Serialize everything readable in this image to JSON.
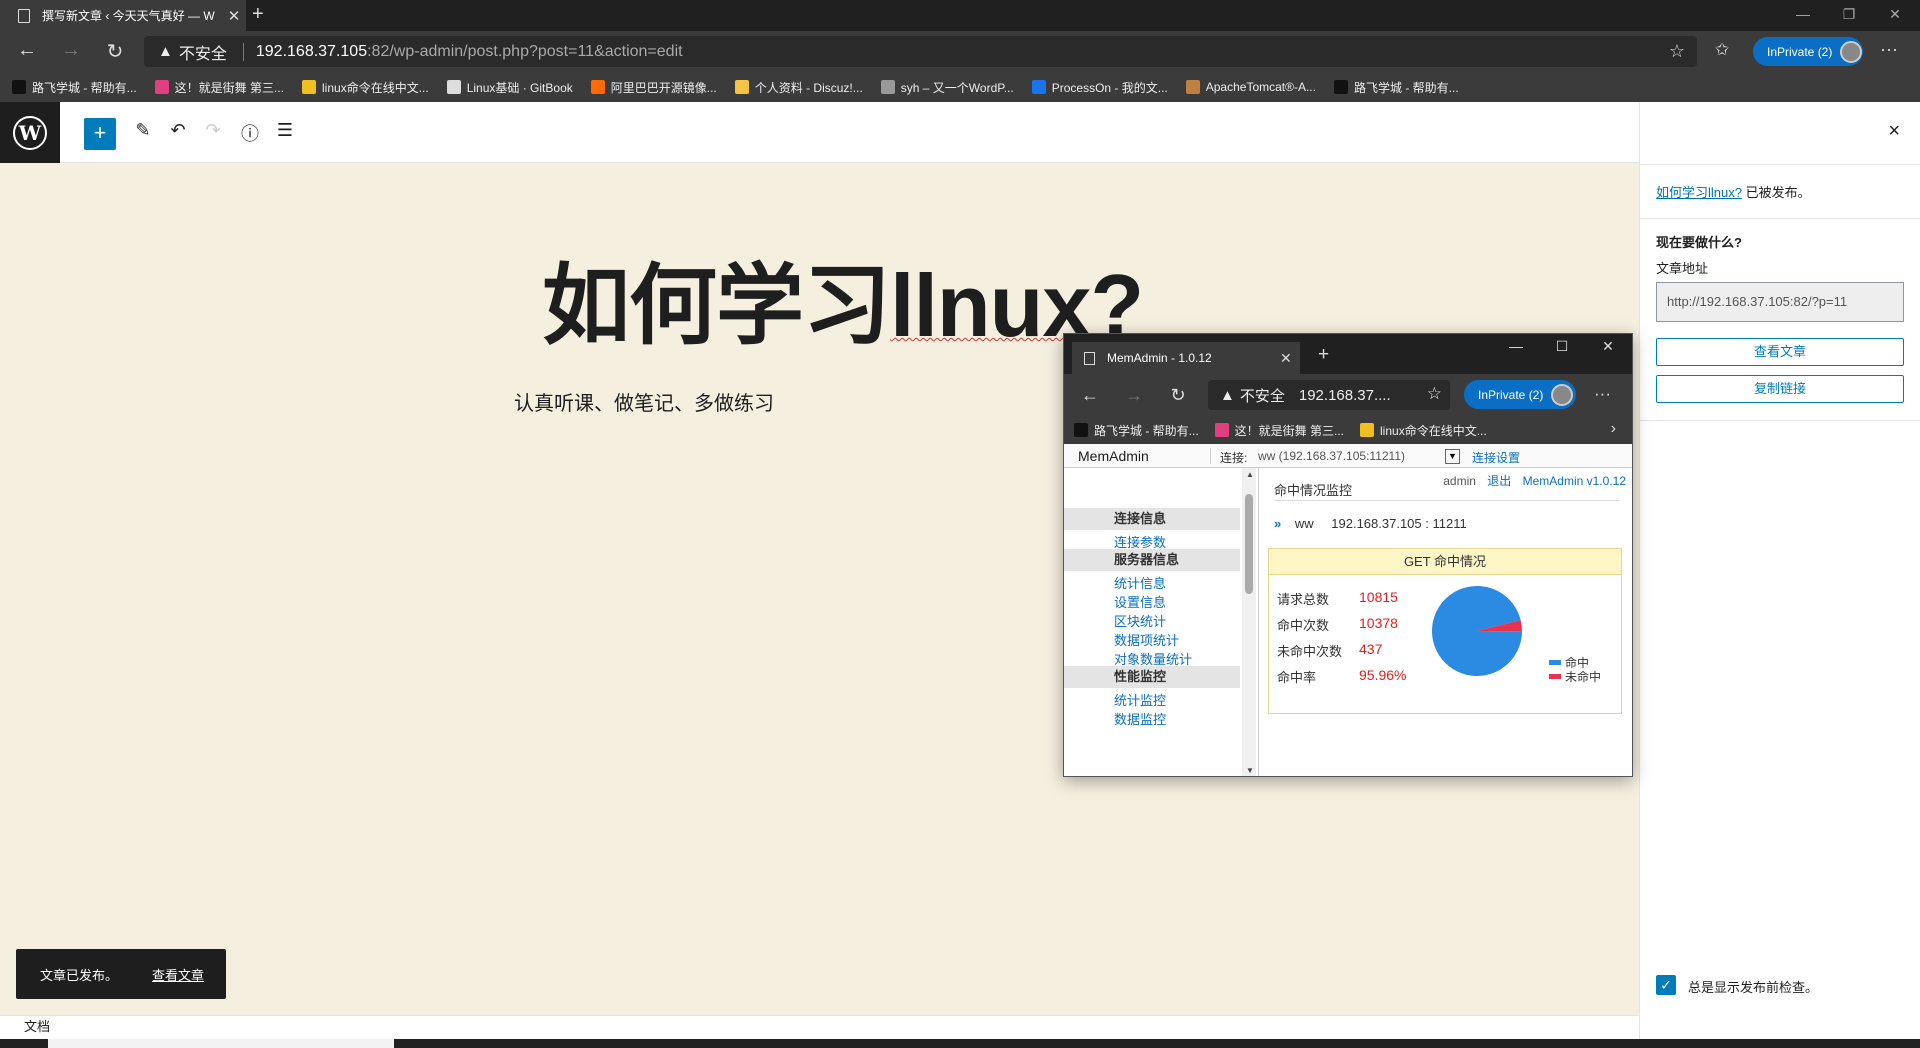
{
  "browser": {
    "tab_title": "撰写新文章 ‹ 今天天气真好 — W",
    "insecure_label": "不安全",
    "url_host": "192.168.37.105",
    "url_rest": ":82/wp-admin/post.php?post=11&action=edit",
    "inprivate_label": "InPrivate (2)",
    "bookmarks": [
      {
        "label": "路飞学城 - 帮助有...",
        "color": "#111111"
      },
      {
        "label": "这！就是街舞 第三...",
        "color": "#e04080"
      },
      {
        "label": "linux命令在线中文...",
        "color": "#f0c020"
      },
      {
        "label": "Linux基础 · GitBook",
        "color": "#dddddd"
      },
      {
        "label": "阿里巴巴开源镜像...",
        "color": "#ff6a00"
      },
      {
        "label": "个人资料 - Discuz!...",
        "color": "#f5c542"
      },
      {
        "label": "syh – 又一个WordP...",
        "color": "#999999"
      },
      {
        "label": "ProcessOn - 我的文...",
        "color": "#1a73e8"
      },
      {
        "label": "ApacheTomcat®-A...",
        "color": "#c08040"
      },
      {
        "label": "路飞学城 - 帮助有...",
        "color": "#111111"
      }
    ]
  },
  "editor": {
    "logo_text": "W",
    "add_symbol": "+",
    "title_prefix": "如何学习",
    "title_word": "llnux",
    "title_suffix": "?",
    "body_text": "认真听课、做笔记、多做练习",
    "snackbar_text": "文章已发布。",
    "snackbar_link": "查看文章",
    "footer_label": "文档"
  },
  "sidebar": {
    "close_symbol": "×",
    "published_link": "如何学习llnux?",
    "published_suffix": " 已被发布。",
    "question": "现在要做什么?",
    "address_label": "文章地址",
    "address_value": "http://192.168.37.105:82/?p=11",
    "view_post_button": "查看文章",
    "copy_link_button": "复制链接",
    "checkbox_label": "总是显示发布前检查。",
    "checkbox_checked": true
  },
  "popup": {
    "tab_title": "MemAdmin - 1.0.12",
    "insecure_label": "不安全",
    "url_text": "192.168.37....",
    "inprivate_label": "InPrivate (2)",
    "bookmarks": [
      {
        "label": "路飞学城 - 帮助有...",
        "color": "#111111"
      },
      {
        "label": "这！就是街舞 第三...",
        "color": "#e04080"
      },
      {
        "label": "linux命令在线中文...",
        "color": "#f0c020"
      }
    ],
    "memadmin": {
      "brand": "MemAdmin",
      "conn_label": "连接:",
      "conn_value": "ww (192.168.37.105:11211)",
      "conn_settings": "连接设置",
      "user": "admin",
      "logout": "退出",
      "version": "MemAdmin v1.0.12",
      "page_title": "命中情况监控",
      "server_name": "ww",
      "server_addr": "192.168.37.105 : 11211",
      "box_title": "GET 命中情况",
      "menu": [
        {
          "type": "section",
          "label": "连接信息"
        },
        {
          "type": "link",
          "label": "连接参数"
        },
        {
          "type": "section",
          "label": "服务器信息"
        },
        {
          "type": "link",
          "label": "统计信息"
        },
        {
          "type": "link",
          "label": "设置信息"
        },
        {
          "type": "link",
          "label": "区块统计"
        },
        {
          "type": "link",
          "label": "数据项统计"
        },
        {
          "type": "link",
          "label": "对象数量统计"
        },
        {
          "type": "section",
          "label": "性能监控"
        },
        {
          "type": "link",
          "label": "统计监控"
        },
        {
          "type": "link",
          "label": "数据监控"
        }
      ],
      "stats": [
        {
          "label": "请求总数",
          "value": "10815"
        },
        {
          "label": "命中次数",
          "value": "10378"
        },
        {
          "label": "未命中次数",
          "value": "437"
        },
        {
          "label": "命中率",
          "value": "95.96%"
        }
      ],
      "legend": [
        {
          "label": "命中",
          "color": "#2b8ae2"
        },
        {
          "label": "未命中",
          "color": "#e8334f"
        }
      ],
      "pie": {
        "hit": 10378,
        "miss": 437
      }
    }
  }
}
